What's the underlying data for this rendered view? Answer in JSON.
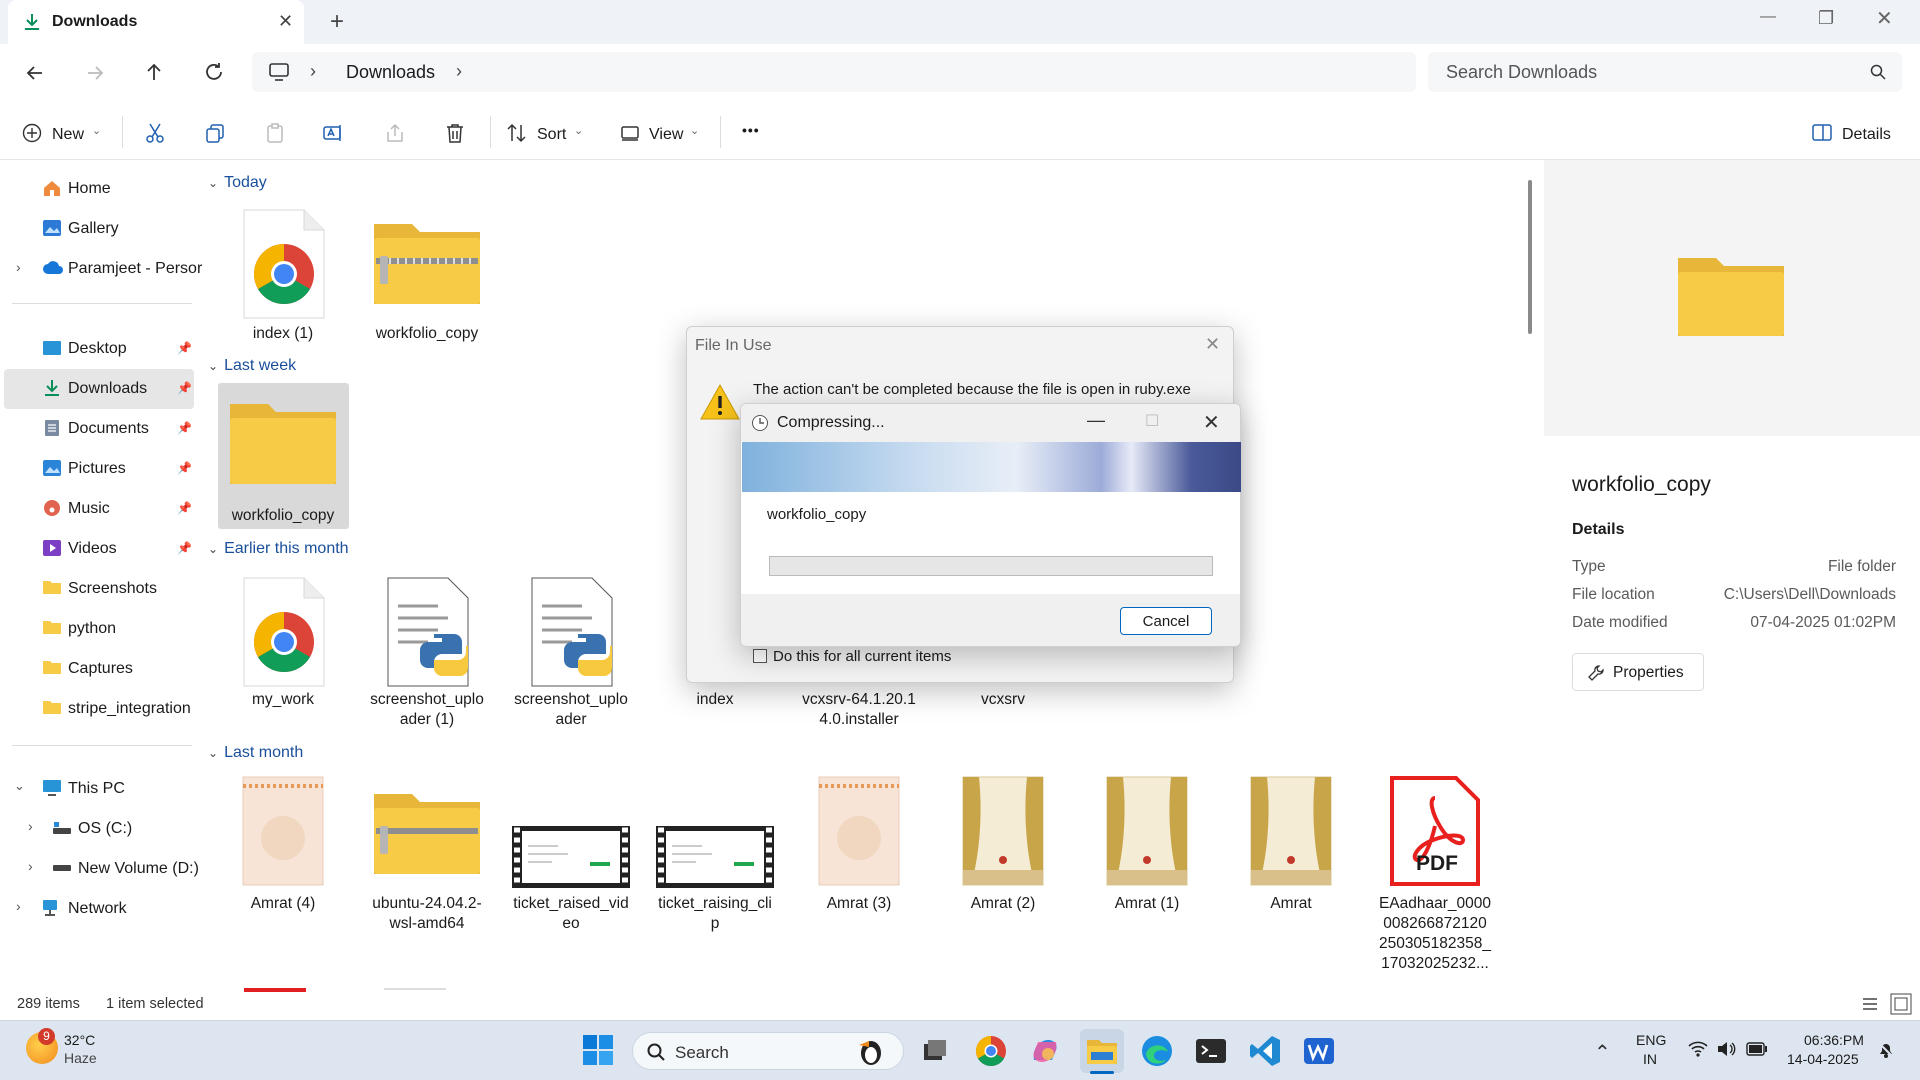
{
  "window": {
    "tab_title": "Downloads",
    "new_tab": "+",
    "controls": {
      "minimize": "—",
      "restore": "❐",
      "close": "✕"
    }
  },
  "nav": {
    "breadcrumb": [
      "Downloads"
    ],
    "search_placeholder": "Search Downloads"
  },
  "toolbar": {
    "new_label": "New",
    "sort_label": "Sort",
    "view_label": "View",
    "more_label": "•••",
    "details_label": "Details"
  },
  "sidebar": {
    "top": [
      {
        "label": "Home"
      },
      {
        "label": "Gallery"
      },
      {
        "label": "Paramjeet - Persor"
      }
    ],
    "pinned": [
      {
        "label": "Desktop"
      },
      {
        "label": "Downloads"
      },
      {
        "label": "Documents"
      },
      {
        "label": "Pictures"
      },
      {
        "label": "Music"
      },
      {
        "label": "Videos"
      },
      {
        "label": "Screenshots"
      },
      {
        "label": "python"
      },
      {
        "label": "Captures"
      },
      {
        "label": "stripe_integration"
      }
    ],
    "pc": [
      {
        "label": "This PC"
      },
      {
        "label": "OS (C:)"
      },
      {
        "label": "New Volume (D:)"
      },
      {
        "label": "Network"
      }
    ]
  },
  "groups": {
    "today": "Today",
    "last_week": "Last week",
    "earlier": "Earlier this month",
    "last_month": "Last month"
  },
  "files": {
    "today": [
      "index (1)",
      "workfolio_copy"
    ],
    "last_week": [
      "workfolio_copy"
    ],
    "earlier": [
      {
        "l1": "my_work",
        "l2": ""
      },
      {
        "l1": "screenshot_uplo",
        "l2": "ader (1)"
      },
      {
        "l1": "screenshot_uplo",
        "l2": "ader"
      },
      {
        "l1": "index",
        "l2": ""
      },
      {
        "l1": "vcxsrv-64.1.20.1",
        "l2": "4.0.installer"
      },
      {
        "l1": "vcxsrv",
        "l2": ""
      }
    ],
    "last_month": [
      {
        "l1": "Amrat (4)",
        "l2": "",
        "l3": "",
        "l4": ""
      },
      {
        "l1": "ubuntu-24.04.2-",
        "l2": "wsl-amd64",
        "l3": "",
        "l4": ""
      },
      {
        "l1": "ticket_raised_vid",
        "l2": "eo",
        "l3": "",
        "l4": ""
      },
      {
        "l1": "ticket_raising_cli",
        "l2": "p",
        "l3": "",
        "l4": ""
      },
      {
        "l1": "Amrat (3)",
        "l2": "",
        "l3": "",
        "l4": ""
      },
      {
        "l1": "Amrat (2)",
        "l2": "",
        "l3": "",
        "l4": ""
      },
      {
        "l1": "Amrat (1)",
        "l2": "",
        "l3": "",
        "l4": ""
      },
      {
        "l1": "Amrat",
        "l2": "",
        "l3": "",
        "l4": ""
      },
      {
        "l1": "EAadhaar_0000",
        "l2": "008266872120",
        "l3": "250305182358_",
        "l4": "17032025232..."
      }
    ],
    "pdf_badge": "PDF"
  },
  "status": {
    "items": "289 items",
    "selected": "1 item selected"
  },
  "details": {
    "name": "workfolio_copy",
    "heading": "Details",
    "rows": [
      {
        "k": "Type",
        "v": "File folder"
      },
      {
        "k": "File location",
        "v": "C:\\Users\\Dell\\Downloads"
      },
      {
        "k": "Date modified",
        "v": "07-04-2025 01:02PM"
      }
    ],
    "properties": "Properties"
  },
  "file_in_use": {
    "title": "File In Use",
    "message": "The action can't be completed because the file is open in ruby.exe",
    "checkbox": "Do this for all current items"
  },
  "compressing": {
    "title": "Compressing...",
    "item": "workfolio_copy",
    "cancel": "Cancel",
    "progress": 0
  },
  "taskbar": {
    "weather_badge": "9",
    "temp": "32°C",
    "condition": "Haze",
    "search": "Search",
    "lang1": "ENG",
    "lang2": "IN",
    "time": "06:36:PM",
    "date": "14-04-2025"
  },
  "colors": {
    "accent": "#0067c0",
    "folder": "#f8cb46",
    "pdf": "#e8201e"
  }
}
